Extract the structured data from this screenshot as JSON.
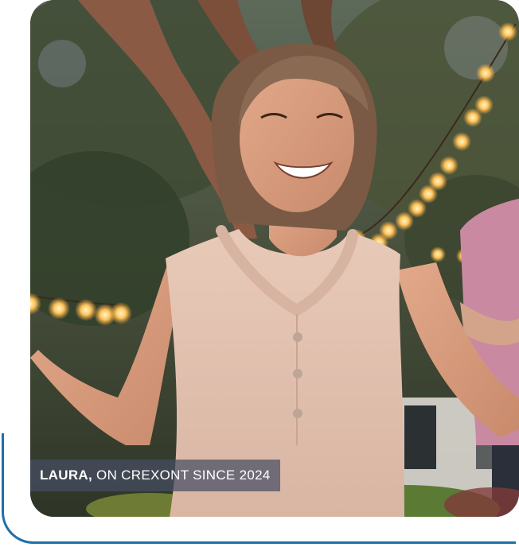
{
  "testimonial": {
    "photo_alt": "Smiling woman with arms outstretched under string lights",
    "caption": {
      "name": "LAURA,",
      "text": "ON CREXONT SINCE 2024"
    }
  },
  "colors": {
    "accent_border": "#1f6fa8",
    "caption_background": "rgba(70,78,100,0.72)",
    "caption_text": "#ffffff"
  }
}
